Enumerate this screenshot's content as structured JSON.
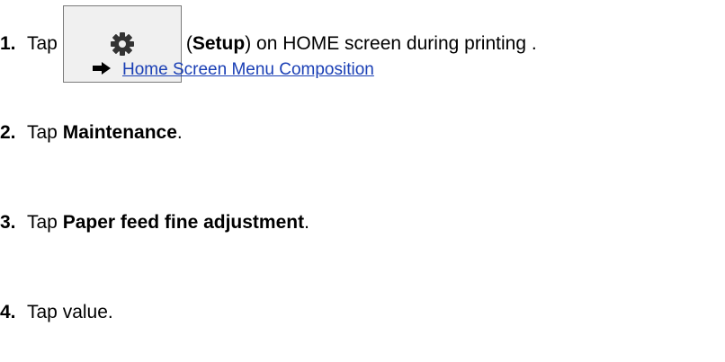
{
  "steps": [
    {
      "number": "1.",
      "text_before": "Tap",
      "button_icon": "gear-icon",
      "bold": "Setup",
      "text_after": "on HOME screen during printing .",
      "link": {
        "icon": "arrow-right-icon",
        "label": "Home Screen Menu Composition"
      }
    },
    {
      "number": "2.",
      "text_before": "Tap",
      "bold": "Maintenance",
      "text_after": "."
    },
    {
      "number": "3.",
      "text_before": "Tap",
      "bold": "Paper feed fine adjustment",
      "text_after": "."
    },
    {
      "number": "4.",
      "text_before": "Tap value."
    }
  ],
  "colors": {
    "link": "#1a3fb5",
    "button_background": "#f0f0f0",
    "button_border": "#7a7a7a",
    "gear": "#333333"
  }
}
